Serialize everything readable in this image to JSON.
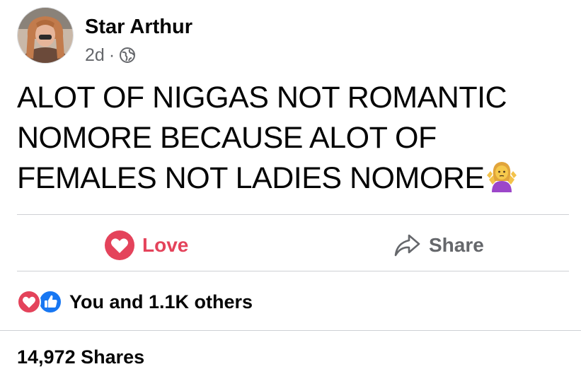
{
  "post": {
    "author_name": "Star Arthur",
    "time_ago": "2d",
    "separator": "·",
    "privacy_icon": "globe-icon",
    "text": "ALOT OF NIGGAS NOT ROMANTIC NOMORE BECAUSE ALOT OF FEMALES NOT LADIES NOMORE",
    "emoji": "woman-shrugging-emoji"
  },
  "actions": {
    "love_label": "Love",
    "love_icon": "love-reaction-icon",
    "share_label": "Share",
    "share_icon": "share-arrow-icon"
  },
  "reactions": {
    "icons": [
      "love-reaction-icon",
      "like-reaction-icon"
    ],
    "summary": "You and 1.1K others"
  },
  "shares": {
    "label": "14,972 Shares"
  },
  "colors": {
    "love_red": "#e4435b",
    "like_blue": "#1877f2",
    "secondary_text": "#65676b",
    "primary_text": "#050505",
    "divider": "#ced0d4"
  }
}
